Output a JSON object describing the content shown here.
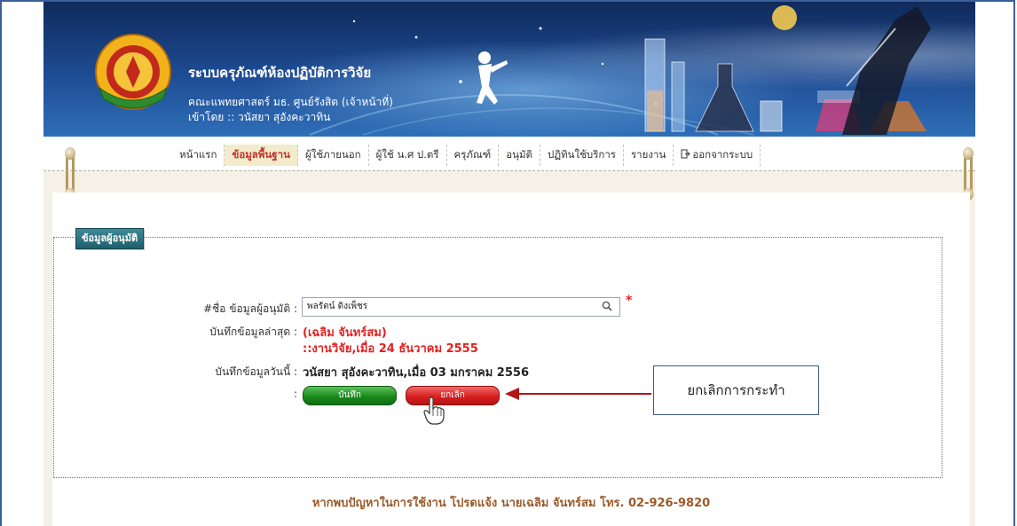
{
  "header": {
    "title": "ระบบครุภัณฑ์ห้องปฏิบัติการวิจัย",
    "subtitle": "คณะแพทยศาสตร์ มธ. ศูนย์รังสิต (เจ้าหน้าที่)",
    "login": "เข้าโดย :: วนัสยา สุอังคะวาทิน",
    "logo_icon": "university-seal-icon"
  },
  "nav": {
    "items": [
      {
        "label": "หน้าแรก",
        "active": false
      },
      {
        "label": "ข้อมูลพื้นฐาน",
        "active": true
      },
      {
        "label": "ผู้ใช้ภายนอก",
        "active": false
      },
      {
        "label": "ผู้ใช้ น.ศ ป.ตรี",
        "active": false
      },
      {
        "label": "ครุภัณฑ์",
        "active": false
      },
      {
        "label": "อนุมัติ",
        "active": false
      },
      {
        "label": "ปฏิทินใช้บริการ",
        "active": false
      },
      {
        "label": "รายงาน",
        "active": false
      },
      {
        "label": "ออกจากระบบ",
        "active": false
      }
    ]
  },
  "form": {
    "legend": "ข้อมูลผู้อนุมัติ",
    "name_label": "#ชื่อ ข้อมูลผู้อนุมัติ :",
    "name_value": "พลรัตน์ ดิงเพ็ชร",
    "required_mark": "*",
    "last_saved_label": "บันทึกข้อมูลล่าสุด :",
    "last_saved_by": "(เฉลิม จันทร์สม)",
    "last_saved_info": "::งานวิจัย,เมื่อ 24 ธันวาคม 2555",
    "today_label": "บันทึกข้อมูลวันนี้ :",
    "today_value": "วนัสยา สุอังคะวาทิน,เมื่อ 03 มกราคม 2556",
    "button_colon": ":",
    "save_label": "บันทึก",
    "cancel_label": "ยกเลิก"
  },
  "annotation": {
    "callout": "ยกเลิกการกระทำ"
  },
  "footer": {
    "text": "หากพบปัญหาในการใช้งาน โปรดแจ้ง นายเฉลิม จันทร์สม โทร. 02-926-9820"
  },
  "colors": {
    "accent_red": "#e32121",
    "save_green": "#1a8a1a",
    "legend_teal": "#1f5f6d"
  }
}
